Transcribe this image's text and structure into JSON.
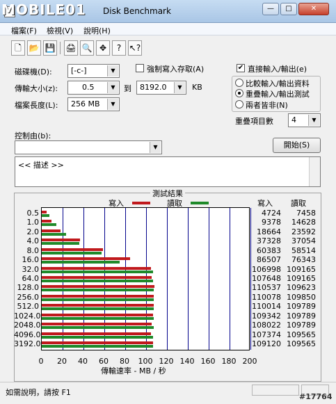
{
  "window": {
    "title": "Disk Benchmark",
    "watermark": "MOBILE01",
    "controls": {
      "minimize": "—",
      "maximize": "□",
      "close": "✕"
    }
  },
  "menu": [
    {
      "label": "檔案(F)"
    },
    {
      "label": "檢視(V)"
    },
    {
      "label": "說明(H)"
    }
  ],
  "toolbar": [
    {
      "icon": "new-icon",
      "glyph": "🗋"
    },
    {
      "icon": "open-icon",
      "glyph": "📂"
    },
    {
      "icon": "save-icon",
      "glyph": "💾"
    },
    {
      "icon": "print-icon",
      "glyph": "🖨"
    },
    {
      "icon": "print-preview-icon",
      "glyph": "🔍"
    },
    {
      "icon": "move-icon",
      "glyph": "✥"
    },
    {
      "icon": "help-icon",
      "glyph": "?"
    },
    {
      "icon": "context-help-icon",
      "glyph": "↖?"
    }
  ],
  "form": {
    "drive_label": "磁碟機(D):",
    "drive_value": "[-c-]",
    "transfer_size_label": "傳輸大小(z):",
    "transfer_from": "0.5",
    "to_label": "到",
    "transfer_to": "8192.0",
    "kb_label": "KB",
    "file_length_label": "檔案長度(L):",
    "file_length_value": "256 MB",
    "force_write_label": "強制寫入存取(A)",
    "force_write_checked": false,
    "direct_io_label": "直接輸入/輸出(e)",
    "direct_io_checked": true,
    "io_compare_label": "比較輸入/輸出資料",
    "overlapped_io_label": "重疊輸入/輸出測試",
    "neither_label": "兩者皆非(N)",
    "io_mode_selected": "overlapped",
    "queue_depth_label": "重疊項目數",
    "queue_depth_value": "4",
    "controller_label": "控制由(b):",
    "controller_value": "",
    "start_label": "開始(S)",
    "description_text": "<<    描述    >>"
  },
  "results": {
    "title": "測試結果",
    "legend_write": "寫入",
    "legend_read": "讀取",
    "col_write": "寫入",
    "col_read": "讀取",
    "write_color": "#c0191c",
    "read_color": "#1f8a2a"
  },
  "chart_data": {
    "type": "bar",
    "orientation": "horizontal",
    "title": "測試結果",
    "xlabel": "傳輸速率 - MB / 秒",
    "xlim": [
      0,
      200
    ],
    "xticks": [
      "0",
      "20",
      "40",
      "60",
      "80",
      "100",
      "120",
      "140",
      "160",
      "180",
      "200"
    ],
    "categories": [
      "0.5",
      "1.0",
      "2.0",
      "4.0",
      "8.0",
      "16.0",
      "32.0",
      "64.0",
      "128.0",
      "256.0",
      "512.0",
      "1024.0",
      "2048.0",
      "4096.0",
      "3192.0"
    ],
    "series": [
      {
        "name": "寫入",
        "values": [
          4724,
          9378,
          18664,
          37328,
          60383,
          86507,
          106998,
          107648,
          110537,
          110078,
          110014,
          109342,
          108022,
          107374,
          109120
        ]
      },
      {
        "name": "讀取",
        "values": [
          7458,
          14628,
          23592,
          37054,
          58514,
          76343,
          109165,
          109165,
          109623,
          109850,
          109789,
          109789,
          109789,
          109565,
          109565
        ]
      }
    ]
  },
  "status": {
    "help_text": "如需說明，請按 F1",
    "post_id": "#17764"
  }
}
